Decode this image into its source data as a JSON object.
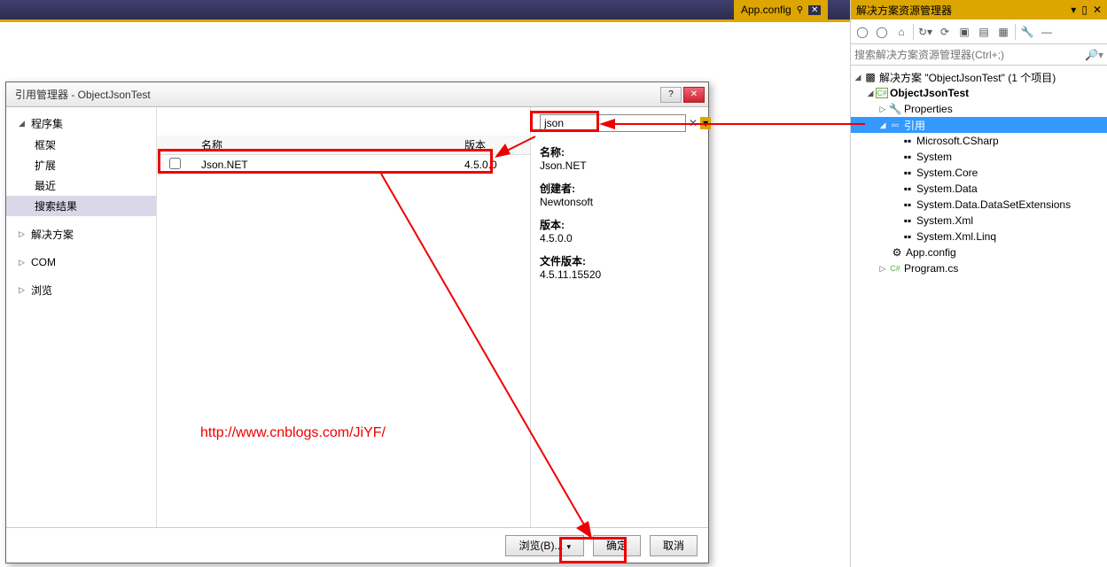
{
  "topTab": {
    "label": "App.config"
  },
  "solutionExplorer": {
    "title": "解决方案资源管理器",
    "searchPlaceholder": "搜索解决方案资源管理器(Ctrl+;)",
    "solutionLine": "解决方案 \"ObjectJsonTest\" (1 个项目)",
    "project": "ObjectJsonTest",
    "properties": "Properties",
    "references": "引用",
    "refs": [
      "Microsoft.CSharp",
      "System",
      "System.Core",
      "System.Data",
      "System.Data.DataSetExtensions",
      "System.Xml",
      "System.Xml.Linq"
    ],
    "appConfig": "App.config",
    "programCs": "Program.cs"
  },
  "dialog": {
    "title": "引用管理器 - ObjectJsonTest",
    "left": {
      "assemblies": "程序集",
      "framework": "框架",
      "extensions": "扩展",
      "recent": "最近",
      "searchResults": "搜索结果",
      "solution": "解决方案",
      "com": "COM",
      "browse": "浏览"
    },
    "cols": {
      "name": "名称",
      "version": "版本"
    },
    "row": {
      "name": "Json.NET",
      "version": "4.5.0.0"
    },
    "search": {
      "value": "json"
    },
    "details": {
      "nameLabel": "名称:",
      "name": "Json.NET",
      "authorLabel": "创建者:",
      "author": "Newtonsoft",
      "versionLabel": "版本:",
      "version": "4.5.0.0",
      "fileVersionLabel": "文件版本:",
      "fileVersion": "4.5.11.15520"
    },
    "buttons": {
      "browse": "浏览(B)...",
      "ok": "确定",
      "cancel": "取消"
    }
  },
  "watermark": "http://www.cnblogs.com/JiYF/"
}
